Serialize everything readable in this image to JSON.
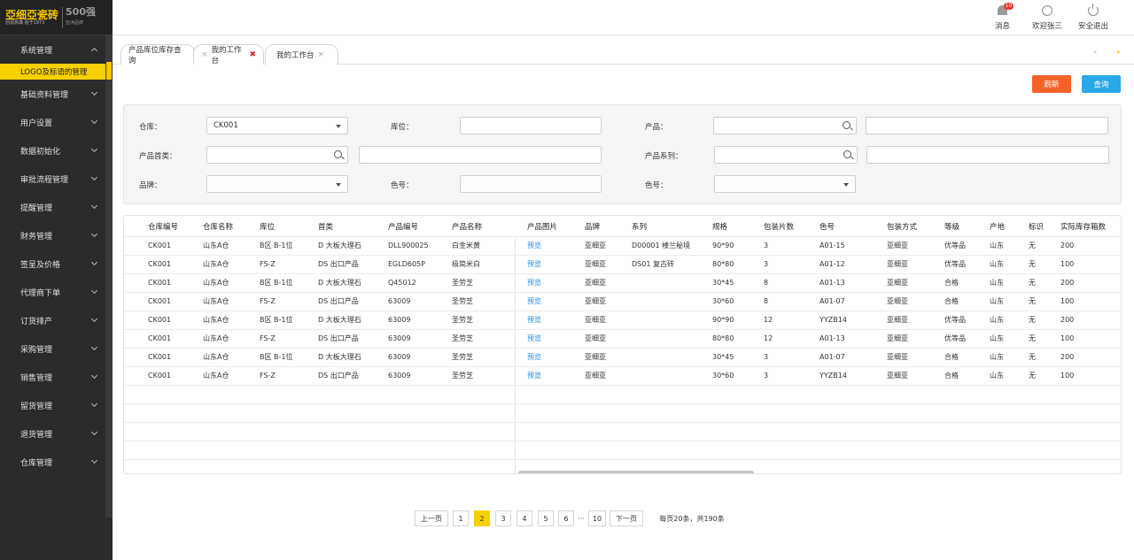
{
  "brand": {
    "logo_text": "亞细亞瓷砖",
    "logo_slogan": "创造高端 始于1973",
    "logo_500": "500强",
    "logo_500_sub": "亚洲品牌",
    "accent_color": "#f5d000"
  },
  "sidebar": {
    "items": [
      {
        "label": "系统管理",
        "open": true
      },
      {
        "label": "基础资料管理"
      },
      {
        "label": "用户设置"
      },
      {
        "label": "数据初始化"
      },
      {
        "label": "审批流程管理"
      },
      {
        "label": "提醒管理"
      },
      {
        "label": "财务管理"
      },
      {
        "label": "签呈及价格"
      },
      {
        "label": "代理商下单"
      },
      {
        "label": "订货排产"
      },
      {
        "label": "采购管理"
      },
      {
        "label": "销售管理"
      },
      {
        "label": "留货管理"
      },
      {
        "label": "退货管理"
      },
      {
        "label": "仓库管理"
      }
    ],
    "submenu_active": "LOGO及标语的管理"
  },
  "header": {
    "messages_label": "消息",
    "messages_badge": "10",
    "welcome_label": "欢迎张三",
    "logout_label": "安全退出"
  },
  "tabs": [
    {
      "label": "产品库位库存查询"
    },
    {
      "label": "我的工作台"
    },
    {
      "label": "我的工作台"
    }
  ],
  "toolbar": {
    "refresh_label": "刷新",
    "refresh_color": "#f4622a",
    "query_label": "查询",
    "query_color": "#29a8e8"
  },
  "filters": {
    "warehouse_label": "仓库：",
    "warehouse_value": "CK001",
    "location_label": "库位：",
    "product_label": "产品：",
    "product_category_label": "产品首类：",
    "product_series_label": "产品系列：",
    "brand_label": "品牌：",
    "color_label": "色号：",
    "color2_label": "色号："
  },
  "table": {
    "headers": [
      "仓库编号",
      "仓库名称",
      "库位",
      "首类",
      "产品编号",
      "产品名称",
      "产品图片",
      "品牌",
      "系列",
      "规格",
      "包装片数",
      "色号",
      "包装方式",
      "等级",
      "产地",
      "标识",
      "实际库存箱数"
    ],
    "rows": [
      [
        "CK001",
        "山东A仓",
        "B区 B-1位",
        "D  大板大理石",
        "DLL900025",
        "白金米黄",
        "预览",
        "亚细亚",
        "D00001 楼兰秘境",
        "90*90",
        "3",
        "A01-15",
        "亚细亚",
        "优等品",
        "山东",
        "无",
        "200"
      ],
      [
        "CK001",
        "山东A仓",
        "FS-Z",
        "DS 出口产品",
        "EGLD605P",
        "极简米白",
        "预览",
        "亚细亚",
        "DS01 复古砖",
        "80*80",
        "3",
        "A01-12",
        "亚细亚",
        "优等品",
        "山东",
        "无",
        "100"
      ],
      [
        "CK001",
        "山东A仓",
        "B区 B-1位",
        "D  大板大理石",
        "Q45012",
        "圣劳芝",
        "预览",
        "亚细亚",
        "",
        "30*45",
        "8",
        "A01-13",
        "亚细亚",
        "合格",
        "山东",
        "无",
        "200"
      ],
      [
        "CK001",
        "山东A仓",
        "FS-Z",
        "DS 出口产品",
        "63009",
        "圣劳芝",
        "预览",
        "亚细亚",
        "",
        "30*60",
        "8",
        "A01-07",
        "亚细亚",
        "合格",
        "山东",
        "无",
        "100"
      ],
      [
        "CK001",
        "山东A仓",
        "B区 B-1位",
        "D  大板大理石",
        "63009",
        "圣劳芝",
        "预览",
        "亚细亚",
        "",
        "90*90",
        "12",
        "YYZB14",
        "亚细亚",
        "优等品",
        "山东",
        "无",
        "200"
      ],
      [
        "CK001",
        "山东A仓",
        "FS-Z",
        "DS 出口产品",
        "63009",
        "圣劳芝",
        "预览",
        "亚细亚",
        "",
        "80*80",
        "12",
        "A01-13",
        "亚细亚",
        "优等品",
        "山东",
        "无",
        "100"
      ],
      [
        "CK001",
        "山东A仓",
        "B区 B-1位",
        "D  大板大理石",
        "63009",
        "圣劳芝",
        "预览",
        "亚细亚",
        "",
        "30*45",
        "3",
        "A01-07",
        "亚细亚",
        "合格",
        "山东",
        "无",
        "200"
      ],
      [
        "CK001",
        "山东A仓",
        "FS-Z",
        "DS 出口产品",
        "63009",
        "圣劳芝",
        "预览",
        "亚细亚",
        "",
        "30*60",
        "3",
        "YYZB14",
        "亚细亚",
        "合格",
        "山东",
        "无",
        "100"
      ]
    ]
  },
  "pagination": {
    "prev_label": "上一页",
    "pages": [
      "1",
      "2",
      "3",
      "4",
      "5",
      "6"
    ],
    "ellipsis": "···",
    "last_page": "10",
    "next_label": "下一页",
    "current": "2",
    "summary": "每页20条，共190条"
  }
}
